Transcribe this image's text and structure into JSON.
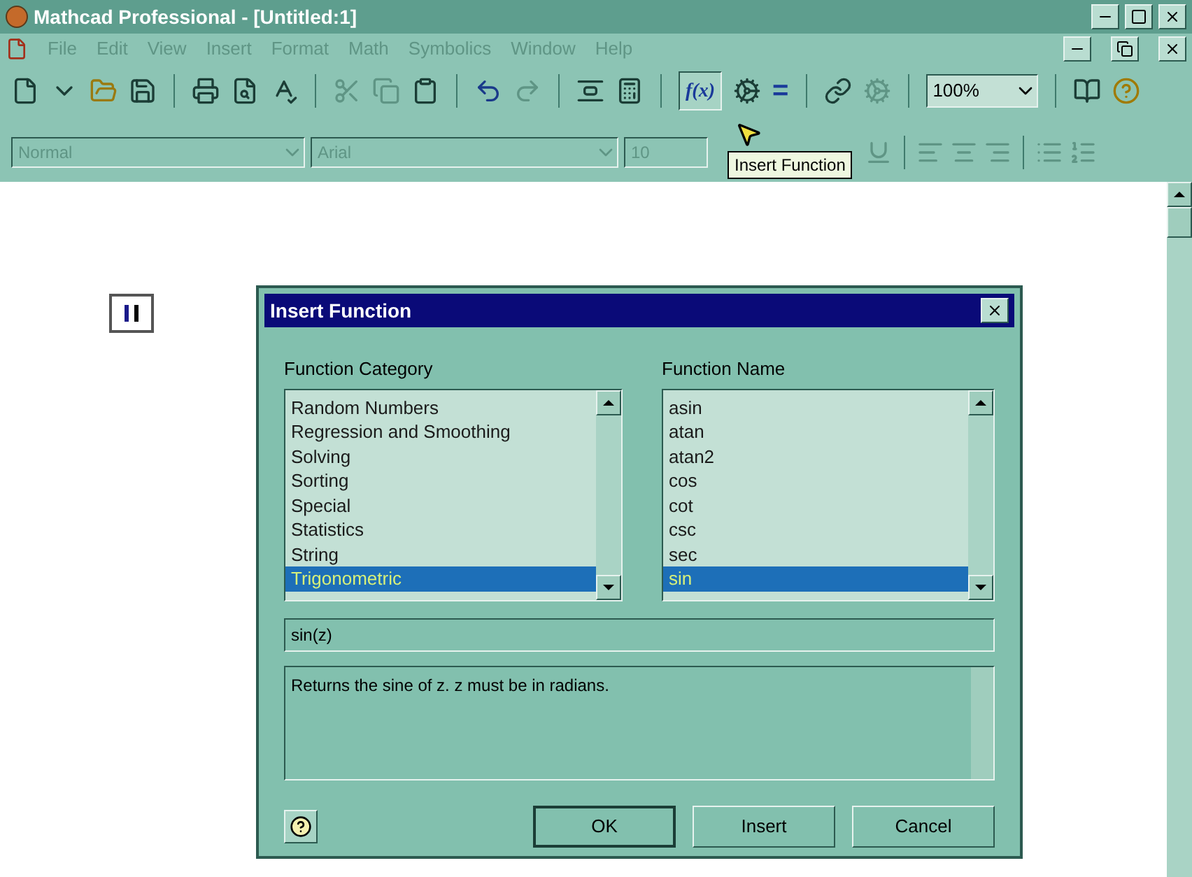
{
  "window": {
    "title": "Mathcad Professional - [Untitled:1]"
  },
  "menu": [
    {
      "label": "File",
      "disabled": true
    },
    {
      "label": "Edit",
      "disabled": true
    },
    {
      "label": "View",
      "disabled": true
    },
    {
      "label": "Insert",
      "disabled": true
    },
    {
      "label": "Format",
      "disabled": true
    },
    {
      "label": "Math",
      "disabled": true
    },
    {
      "label": "Symbolics",
      "disabled": true
    },
    {
      "label": "Window",
      "disabled": true
    },
    {
      "label": "Help",
      "disabled": true
    }
  ],
  "toolbar": {
    "function_button": {
      "label": "f(x)",
      "selected": true
    },
    "equals_button": "=",
    "zoom": "100%"
  },
  "format_bar": {
    "style": "Normal",
    "font": "Arial",
    "size": "10"
  },
  "tooltip": "Insert Function",
  "dialog": {
    "title": "Insert Function",
    "category_label": "Function Category",
    "categories": [
      {
        "label": "Random Numbers",
        "selected": false
      },
      {
        "label": "Regression and Smoothing",
        "selected": false
      },
      {
        "label": "Solving",
        "selected": false
      },
      {
        "label": "Sorting",
        "selected": false
      },
      {
        "label": "Special",
        "selected": false
      },
      {
        "label": "Statistics",
        "selected": false
      },
      {
        "label": "String",
        "selected": false
      },
      {
        "label": "Trigonometric",
        "selected": true
      }
    ],
    "name_label": "Function Name",
    "names": [
      {
        "label": "asin",
        "selected": false
      },
      {
        "label": "atan",
        "selected": false
      },
      {
        "label": "atan2",
        "selected": false
      },
      {
        "label": "cos",
        "selected": false
      },
      {
        "label": "cot",
        "selected": false
      },
      {
        "label": "csc",
        "selected": false
      },
      {
        "label": "sec",
        "selected": false
      },
      {
        "label": "sin",
        "selected": true
      }
    ],
    "signature": "sin(z)",
    "description": "Returns the sine of z. z must be in radians.",
    "buttons": [
      "OK",
      "Insert",
      "Cancel"
    ]
  }
}
